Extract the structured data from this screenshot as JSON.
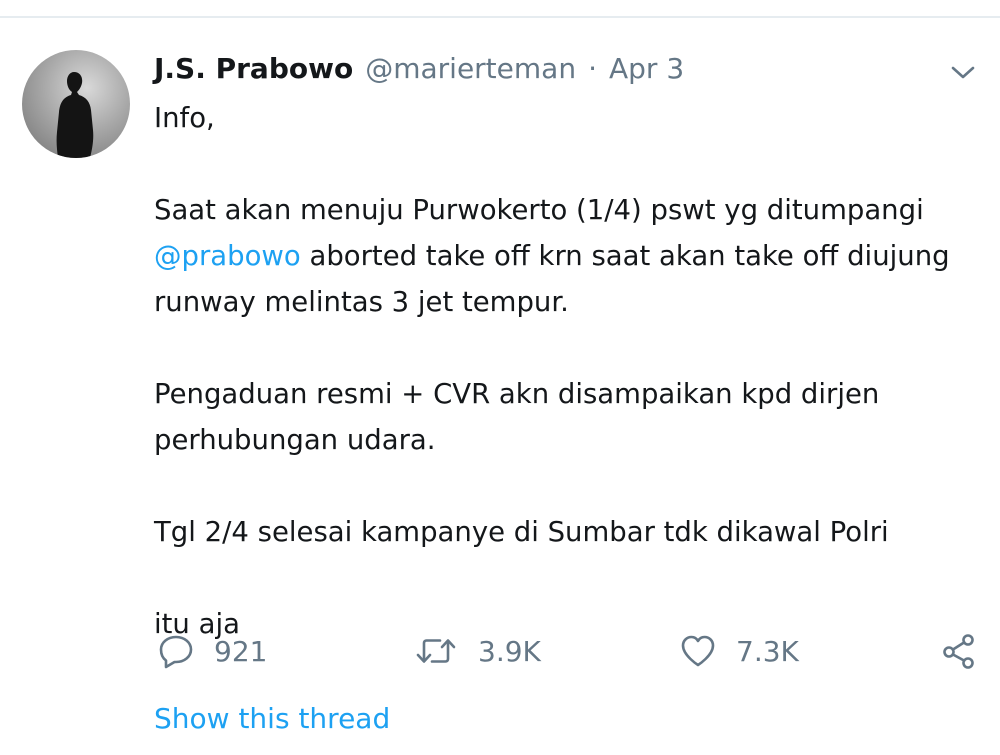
{
  "tweet": {
    "author": {
      "display_name": "J.S. Prabowo",
      "handle": "@marierteman"
    },
    "separator": "·",
    "date": "Apr 3",
    "body": {
      "line_info": "Info,",
      "p1_before": "Saat akan menuju Purwokerto (1/4) pswt yg ditumpangi",
      "p1_mention": "@prabowo",
      "p1_after": "aborted take off krn saat akan take off diujung runway melintas 3 jet tempur.",
      "p2": "Pengaduan resmi + CVR akn disampaikan kpd dirjen perhubungan udara.",
      "p3": "Tgl 2/4 selesai kampanye di Sumbar tdk dikawal Polri",
      "p4": "itu aja"
    },
    "stats": {
      "replies": "921",
      "retweets": "3.9K",
      "likes": "7.3K"
    },
    "show_thread_label": "Show this thread"
  },
  "icons": {
    "more": "chevron-down-icon",
    "reply": "reply-icon",
    "retweet": "retweet-icon",
    "like": "heart-icon",
    "share": "share-icon"
  },
  "colors": {
    "link": "#1da1f2",
    "muted": "#657786",
    "text": "#14171a"
  }
}
